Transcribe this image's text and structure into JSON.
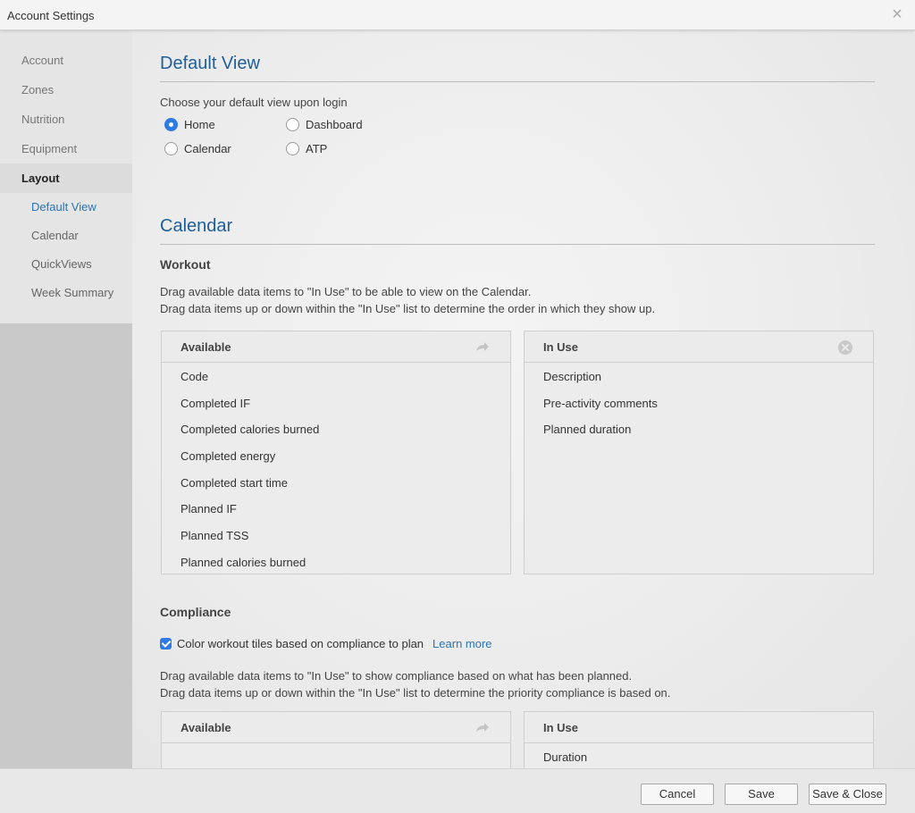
{
  "window": {
    "title": "Account Settings",
    "close_symbol": "×"
  },
  "sidebar": {
    "items": [
      {
        "label": "Account"
      },
      {
        "label": "Zones"
      },
      {
        "label": "Nutrition"
      },
      {
        "label": "Equipment"
      },
      {
        "label": "Layout",
        "active": true
      }
    ],
    "subitems": [
      {
        "label": "Default View",
        "active": true
      },
      {
        "label": "Calendar"
      },
      {
        "label": "QuickViews"
      },
      {
        "label": "Week Summary"
      }
    ]
  },
  "default_view": {
    "title": "Default View",
    "prompt": "Choose your default view upon login",
    "options": [
      {
        "label": "Home",
        "checked": true
      },
      {
        "label": "Dashboard",
        "checked": false
      },
      {
        "label": "Calendar",
        "checked": false
      },
      {
        "label": "ATP",
        "checked": false
      }
    ]
  },
  "calendar": {
    "title": "Calendar",
    "workout": {
      "heading": "Workout",
      "instructions_1": "Drag available data items to \"In Use\" to be able to view on the Calendar.",
      "instructions_2": "Drag data items up or down within the \"In Use\" list to determine the order in which they show up.",
      "available": {
        "header": "Available",
        "icon": "arrow-right-icon",
        "items": [
          "Code",
          "Completed IF",
          "Completed calories burned",
          "Completed energy",
          "Completed start time",
          "Planned IF",
          "Planned TSS",
          "Planned calories burned"
        ]
      },
      "in_use": {
        "header": "In Use",
        "icon": "clear-circle-icon",
        "items": [
          "Description",
          "Pre-activity comments",
          "Planned duration"
        ]
      }
    },
    "compliance": {
      "heading": "Compliance",
      "checkbox_label": "Color workout tiles based on compliance to plan",
      "checkbox_checked": true,
      "learn_more": "Learn more",
      "instructions_1": "Drag available data items to \"In Use\" to show compliance based on what has been planned.",
      "instructions_2": "Drag data items up or down within the \"In Use\" list to determine the priority compliance is based on.",
      "available": {
        "header": "Available",
        "items": []
      },
      "in_use": {
        "header": "In Use",
        "items": [
          "Duration"
        ]
      }
    }
  },
  "footer": {
    "cancel": "Cancel",
    "save": "Save",
    "save_close": "Save & Close"
  },
  "colors": {
    "accent": "#2f7ae5",
    "heading": "#1f5f99",
    "link": "#2e74b5"
  }
}
